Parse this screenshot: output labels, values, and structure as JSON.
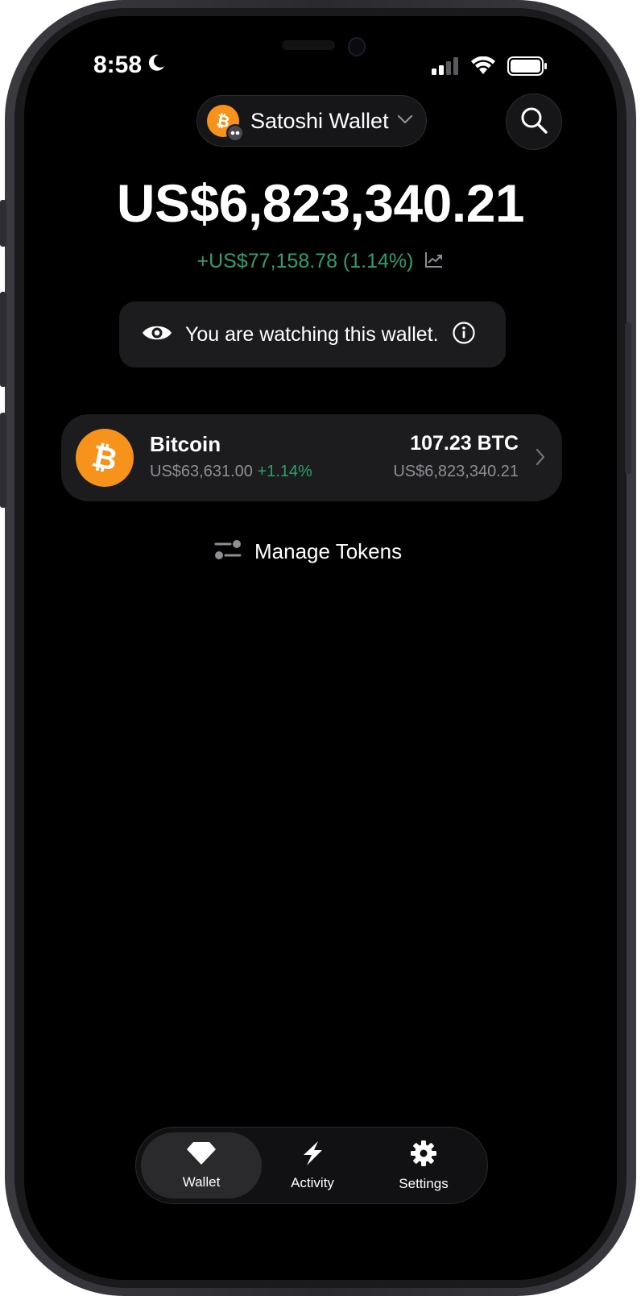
{
  "status_bar": {
    "time": "8:58",
    "icons": [
      "moon-icon",
      "cellular-signal-icon",
      "wifi-icon",
      "battery-icon"
    ]
  },
  "header": {
    "wallet_name": "Satoshi Wallet",
    "wallet_avatar": "bitcoin-icon",
    "search_icon": "search-icon"
  },
  "portfolio": {
    "balance": "US$6,823,340.21",
    "change": "+US$77,158.78 (1.14%)",
    "change_color": "#2f9e6b"
  },
  "watch_banner": {
    "text": "You are watching this wallet."
  },
  "tokens": [
    {
      "name": "Bitcoin",
      "price": "US$63,631.00",
      "price_change": "+1.14%",
      "amount": "107.23 BTC",
      "value": "US$6,823,340.21",
      "color": "#f7931a"
    }
  ],
  "manage_tokens": {
    "label": "Manage Tokens"
  },
  "tab_bar": {
    "tabs": [
      {
        "label": "Wallet",
        "icon": "diamond-icon",
        "active": true
      },
      {
        "label": "Activity",
        "icon": "lightning-icon",
        "active": false
      },
      {
        "label": "Settings",
        "icon": "gear-icon",
        "active": false
      }
    ]
  }
}
